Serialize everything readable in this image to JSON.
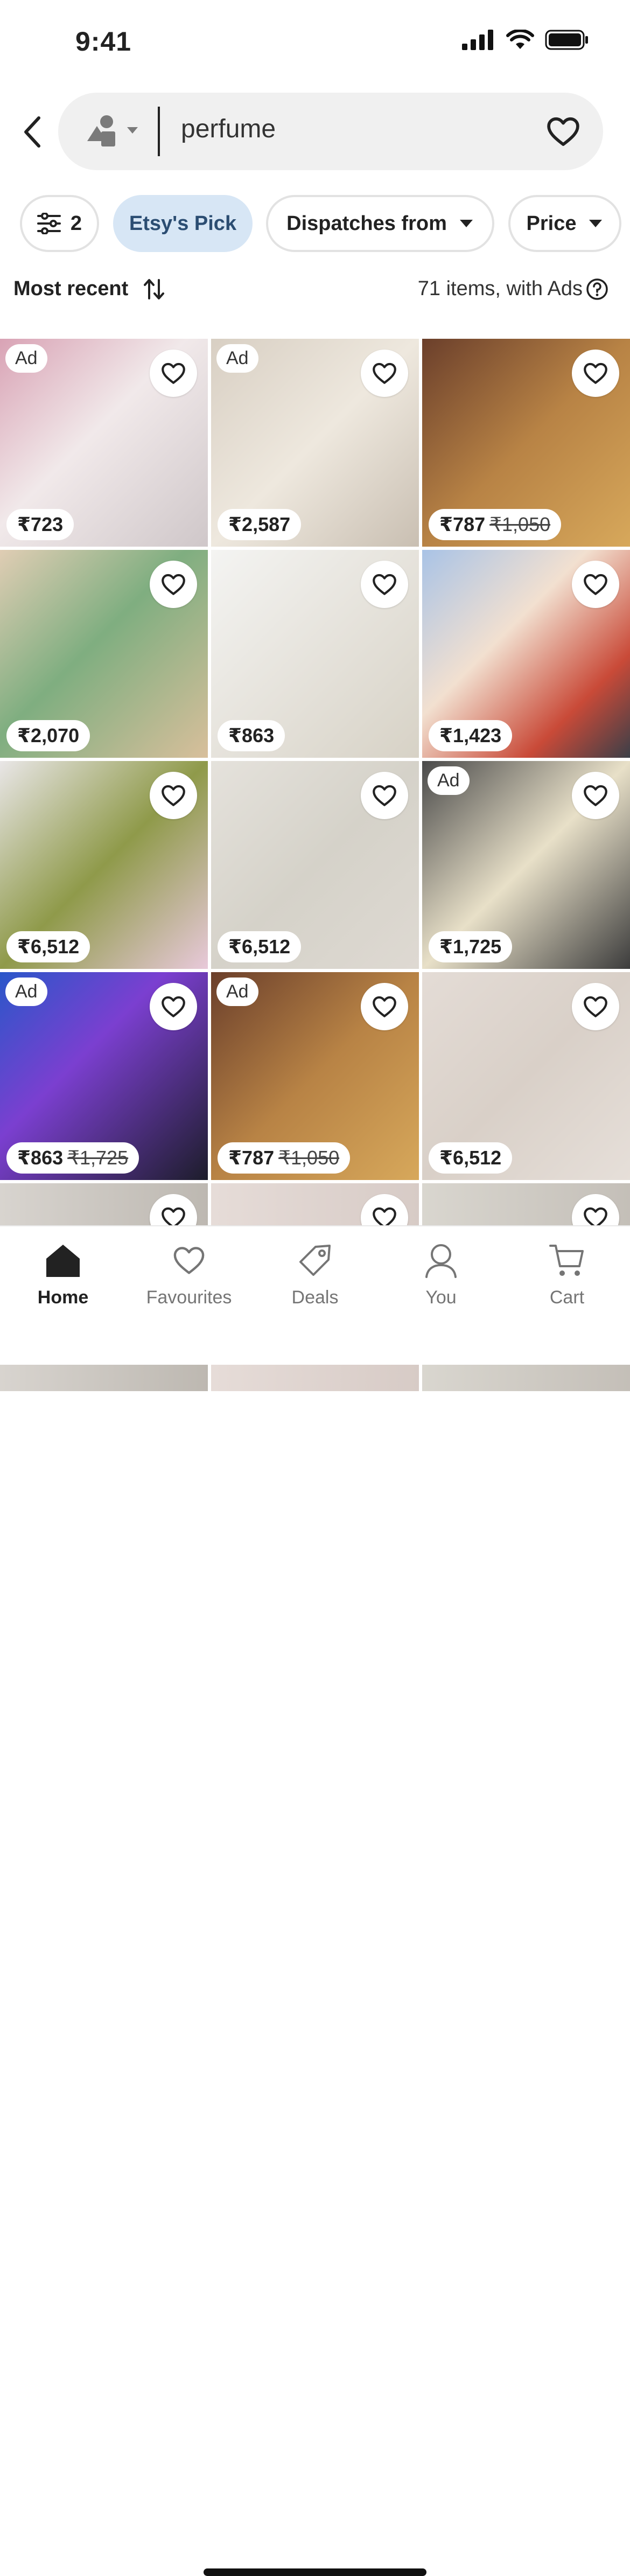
{
  "status": {
    "time": "9:41"
  },
  "search": {
    "query": "perfume"
  },
  "filters": [
    {
      "label": "2",
      "icon": "sliders-icon"
    },
    {
      "label": "Etsy's Pick"
    },
    {
      "label": "Dispatches from"
    },
    {
      "label": "Price"
    }
  ],
  "sort": {
    "label": "Most recent"
  },
  "results": {
    "count_text": "71 items, with Ads"
  },
  "products": [
    {
      "price": "₹723",
      "original": "",
      "ad": "Ad",
      "bg": "linear-gradient(135deg,#d9a3b5 0%,#f1e9ea 45%,#cfc7c9 100%)"
    },
    {
      "price": "₹2,587",
      "original": "",
      "ad": "Ad",
      "bg": "linear-gradient(135deg,#d8cfc3 0%,#eee8de 50%,#c9bfb2 100%)"
    },
    {
      "price": "₹787",
      "original": "₹1,050",
      "ad": "",
      "bg": "linear-gradient(135deg,#6b3f2b 0%,#b88345 50%,#d7a85b 100%)"
    },
    {
      "price": "₹2,070",
      "original": "",
      "ad": "",
      "bg": "linear-gradient(135deg,#e0cdb4 0%,#7fae80 45%,#d8bf9b 100%)"
    },
    {
      "price": "₹863",
      "original": "",
      "ad": "",
      "bg": "linear-gradient(135deg,#f4f4f2 0%,#e6e3dc 50%,#d7d2c6 100%)"
    },
    {
      "price": "₹1,423",
      "original": "",
      "ad": "",
      "bg": "linear-gradient(135deg,#a9c3e6 0%,#f2e0d0 40%,#c94a38 75%,#3b3f48 100%)"
    },
    {
      "price": "₹6,512",
      "original": "",
      "ad": "",
      "bg": "linear-gradient(135deg,#e9e6e7 0%,#8f9a4a 50%,#e8c9da 100%)"
    },
    {
      "price": "₹6,512",
      "original": "",
      "ad": "",
      "bg": "linear-gradient(135deg,#e5e2dc 0%,#d5d2c9 50%,#ded9d2 100%)"
    },
    {
      "price": "₹1,725",
      "original": "",
      "ad": "Ad",
      "bg": "linear-gradient(135deg,#4a4a4a 0%,#e8e0c8 50%,#3c3c3c 100%)"
    },
    {
      "price": "₹863",
      "original": "₹1,725",
      "ad": "Ad",
      "bg": "linear-gradient(135deg,#2a57c9 0%,#7b3fd0 40%,#1d1d2b 100%)"
    },
    {
      "price": "₹787",
      "original": "₹1,050",
      "ad": "Ad",
      "bg": "linear-gradient(135deg,#6b3f2b 0%,#b88345 50%,#d7a85b 100%)"
    },
    {
      "price": "₹6,512",
      "original": "",
      "ad": "",
      "bg": "linear-gradient(135deg,#e4dcd6 0%,#d9d0c8 50%,#e6dfd9 100%)"
    }
  ],
  "partial_row_bgs": [
    "linear-gradient(90deg,#d8d4cf,#bdb8b1)",
    "linear-gradient(90deg,#e6dcd8,#d7cbc6)",
    "linear-gradient(90deg,#d9d6cf,#c4bfb8)"
  ],
  "nav": [
    {
      "label": "Home",
      "icon": "home-icon",
      "active": true
    },
    {
      "label": "Favourites",
      "icon": "heart-icon",
      "active": false
    },
    {
      "label": "Deals",
      "icon": "tag-icon",
      "active": false
    },
    {
      "label": "You",
      "icon": "person-icon",
      "active": false
    },
    {
      "label": "Cart",
      "icon": "cart-icon",
      "active": false
    }
  ]
}
